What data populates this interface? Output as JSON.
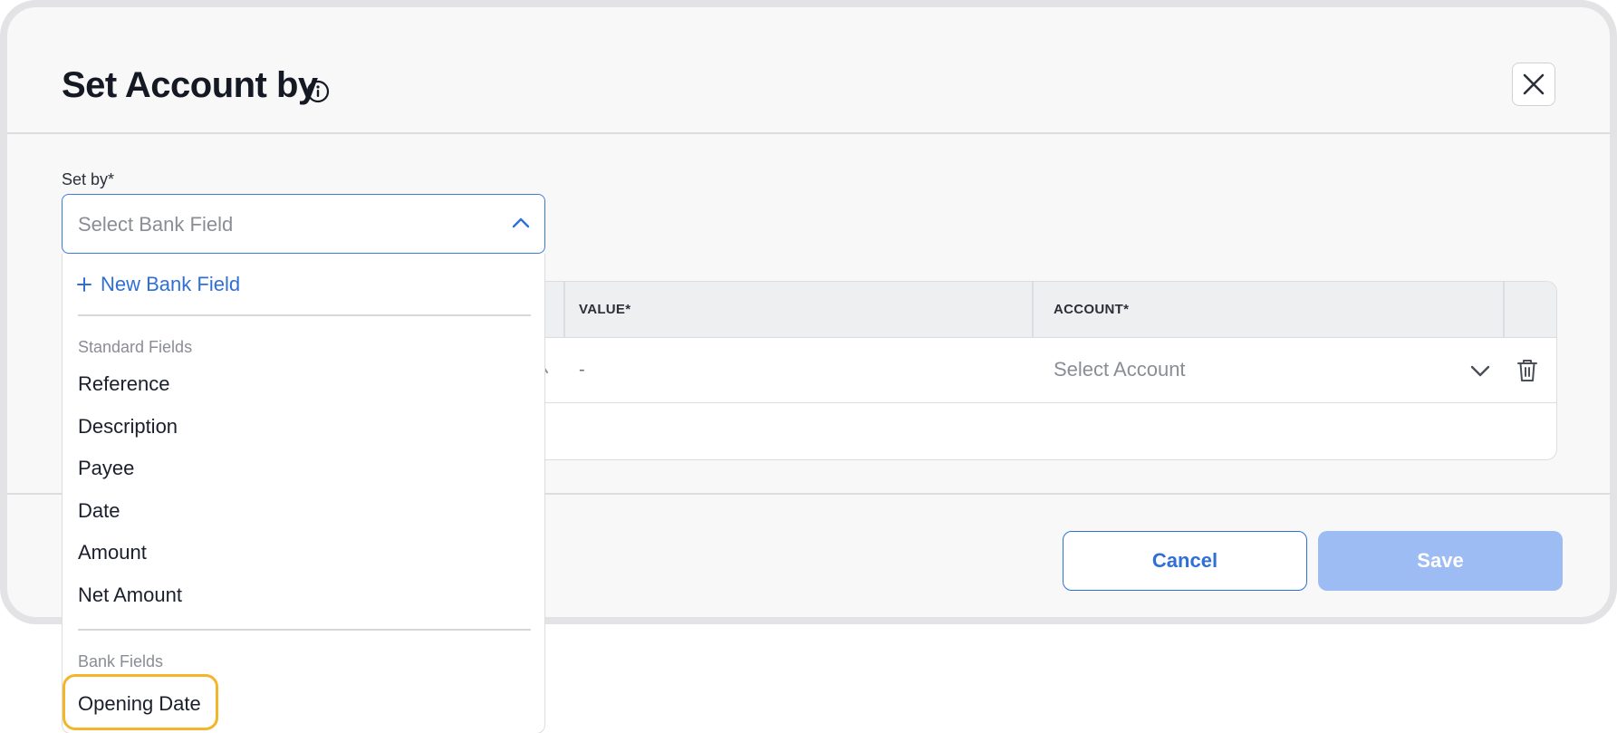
{
  "modal": {
    "title": "Set Account by",
    "close_label": "✕"
  },
  "form": {
    "set_by_label": "Set by*",
    "select_placeholder": "Select Bank Field"
  },
  "table": {
    "headers": [
      "VALUE*",
      "ACCOUNT*"
    ],
    "row": {
      "value": "-",
      "account_placeholder": "Select Account"
    }
  },
  "dropdown": {
    "new_item": "New Bank Field",
    "standard_group": "Standard Fields",
    "standard_items": [
      "Reference",
      "Description",
      "Payee",
      "Date",
      "Amount",
      "Net Amount"
    ],
    "bank_group": "Bank Fields",
    "bank_items": [
      "Opening Date"
    ]
  },
  "footer": {
    "cancel_label": "Cancel",
    "save_label": "Save"
  },
  "colors": {
    "accent": "#2f6fd6",
    "save_disabled": "#9dbcf3",
    "highlight": "#f3b52a"
  }
}
